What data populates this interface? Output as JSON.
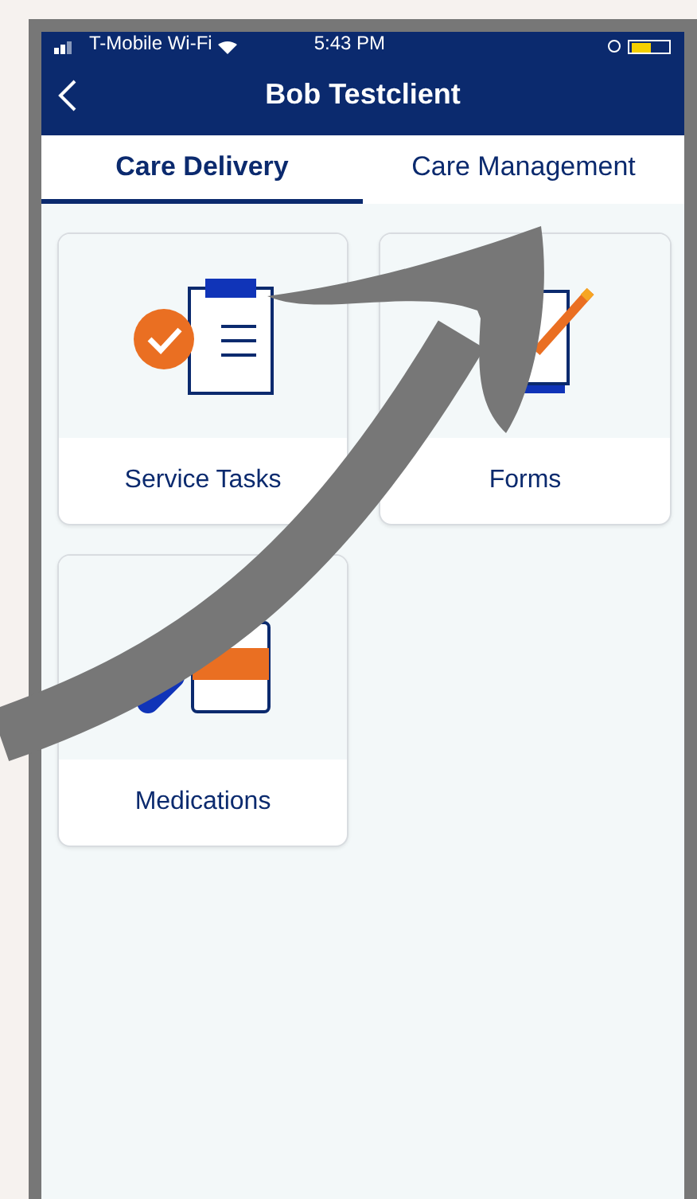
{
  "status_bar": {
    "carrier": "T-Mobile Wi-Fi",
    "time": "5:43 PM"
  },
  "header": {
    "title": "Bob Testclient"
  },
  "tabs": [
    {
      "label": "Care Delivery",
      "selected": true
    },
    {
      "label": "Care Management",
      "selected": false
    }
  ],
  "cards": [
    {
      "label": "Service Tasks",
      "kind": "tasks"
    },
    {
      "label": "Forms",
      "kind": "forms"
    },
    {
      "label": "Medications",
      "kind": "medications"
    }
  ]
}
